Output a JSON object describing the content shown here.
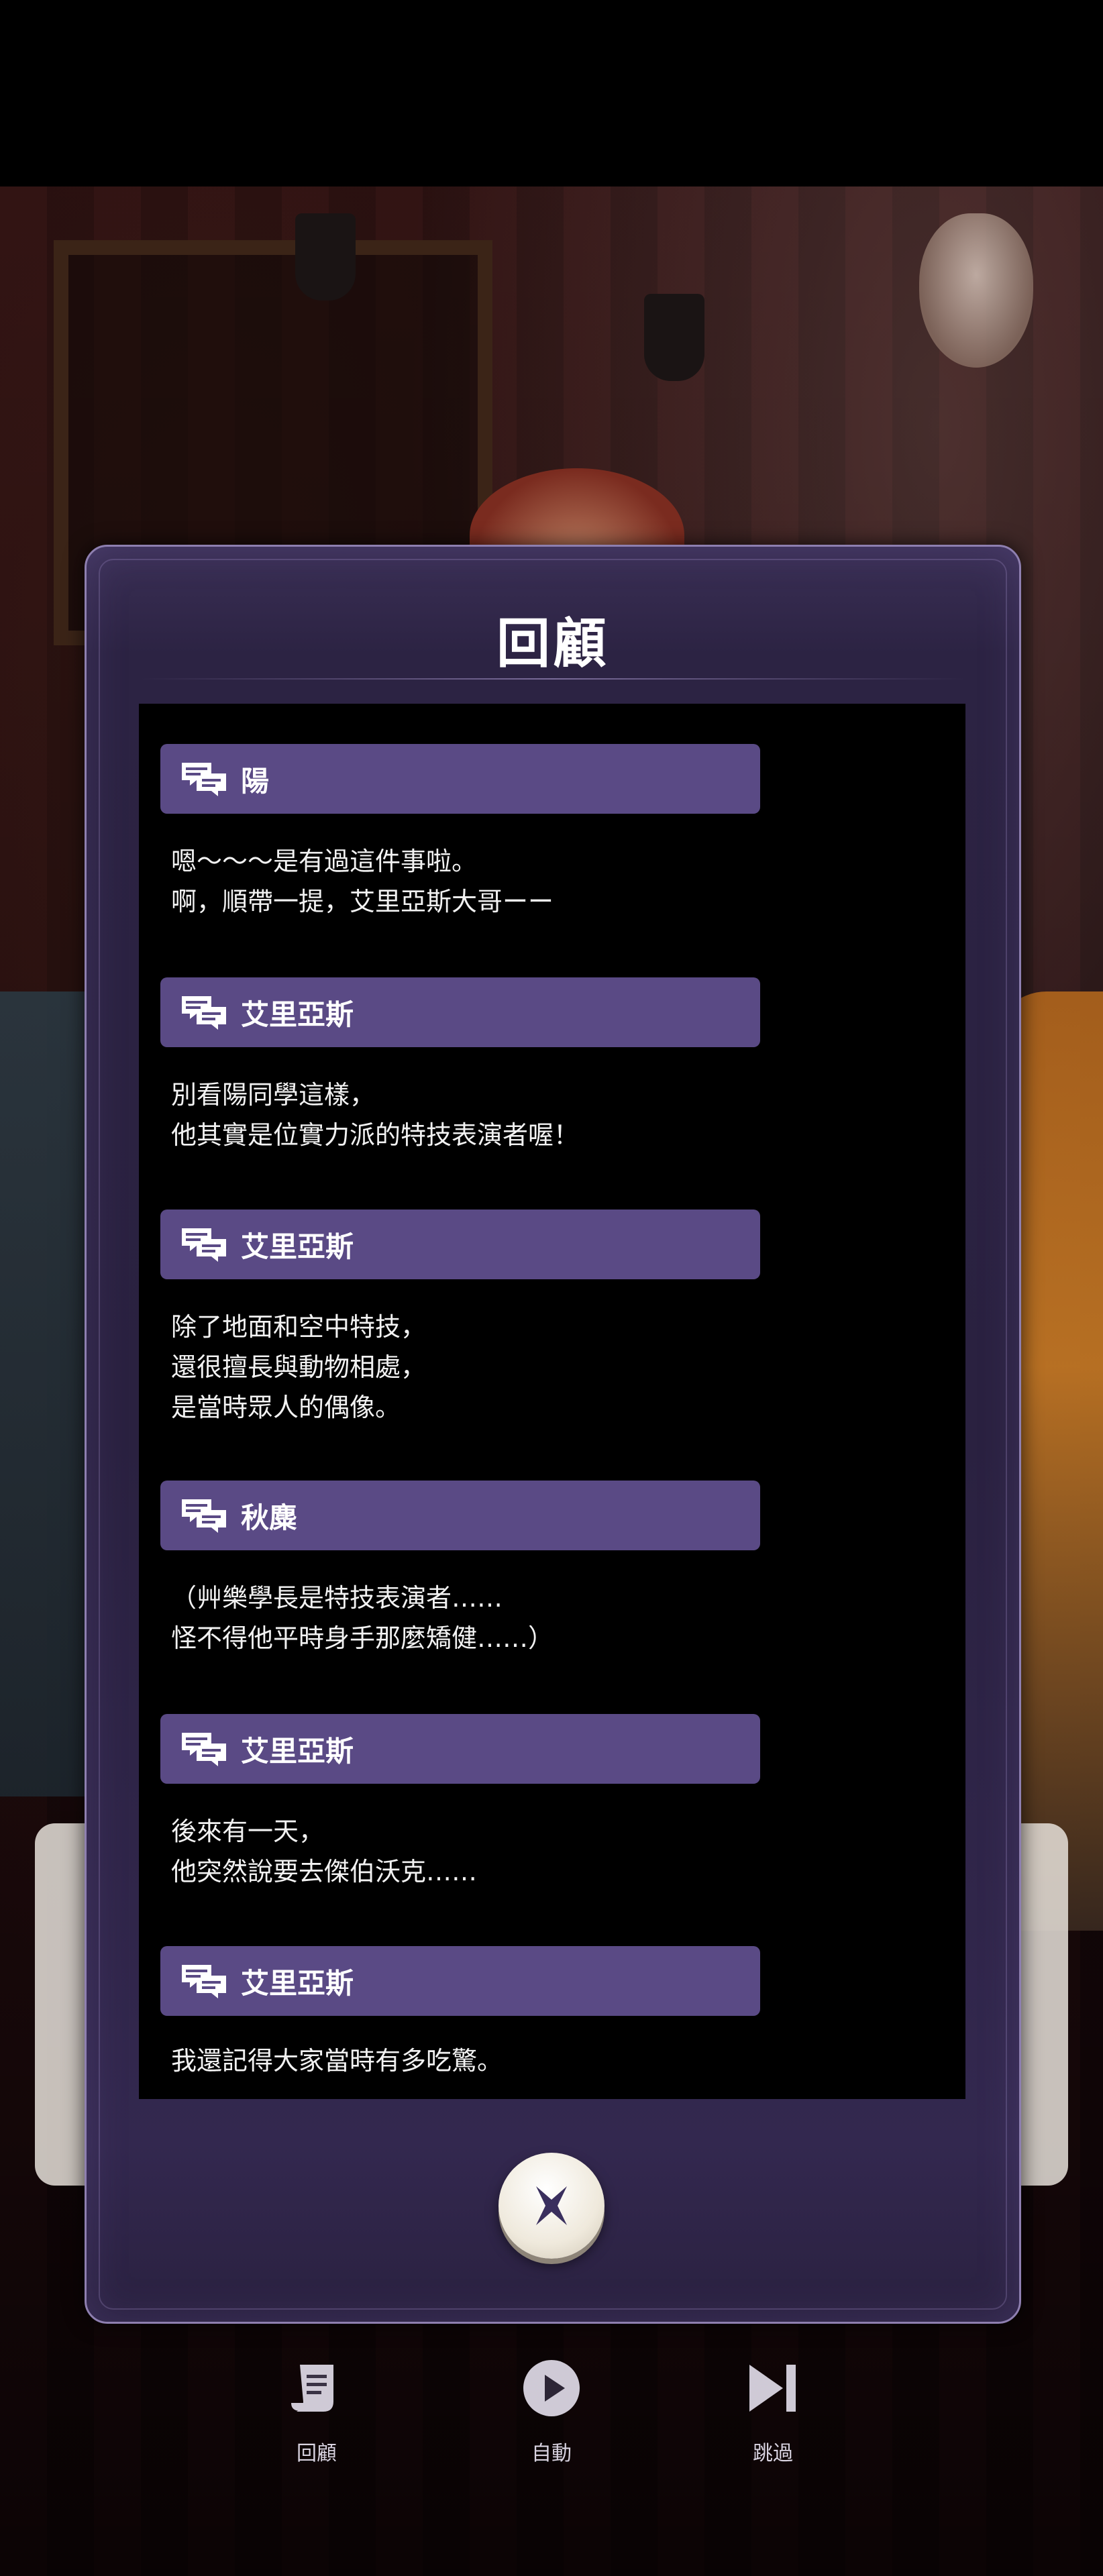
{
  "modal": {
    "title": "回顧",
    "entries": [
      {
        "speaker": "陽",
        "lines": [
          "嗯～～～是有過這件事啦。",
          "啊，順帶一提，艾里亞斯大哥ーー"
        ]
      },
      {
        "speaker": "艾里亞斯",
        "lines": [
          "別看陽同學這樣，",
          "他其實是位實力派的特技表演者喔！"
        ]
      },
      {
        "speaker": "艾里亞斯",
        "lines": [
          "除了地面和空中特技，",
          "還很擅長與動物相處，",
          "是當時眾人的偶像。"
        ]
      },
      {
        "speaker": "秋麋",
        "lines": [
          "（艸樂學長是特技表演者……",
          "怪不得他平時身手那麼矯健……）"
        ]
      },
      {
        "speaker": "艾里亞斯",
        "lines": [
          "後來有一天，",
          "他突然說要去傑伯沃克……"
        ]
      },
      {
        "speaker": "艾里亞斯",
        "lines": [
          "我還記得大家當時有多吃驚。"
        ]
      }
    ],
    "close_icon": "close-x-icon"
  },
  "bottom_menu": {
    "items": [
      {
        "label": "回顧",
        "icon": "scroll-icon"
      },
      {
        "label": "自動",
        "icon": "play-icon"
      },
      {
        "label": "跳過",
        "icon": "skip-icon"
      }
    ]
  },
  "colors": {
    "modal_bg": "#2a2140",
    "name_bar": "#5a4a85",
    "log_bg": "#000000",
    "text": "#f2f2f2"
  }
}
